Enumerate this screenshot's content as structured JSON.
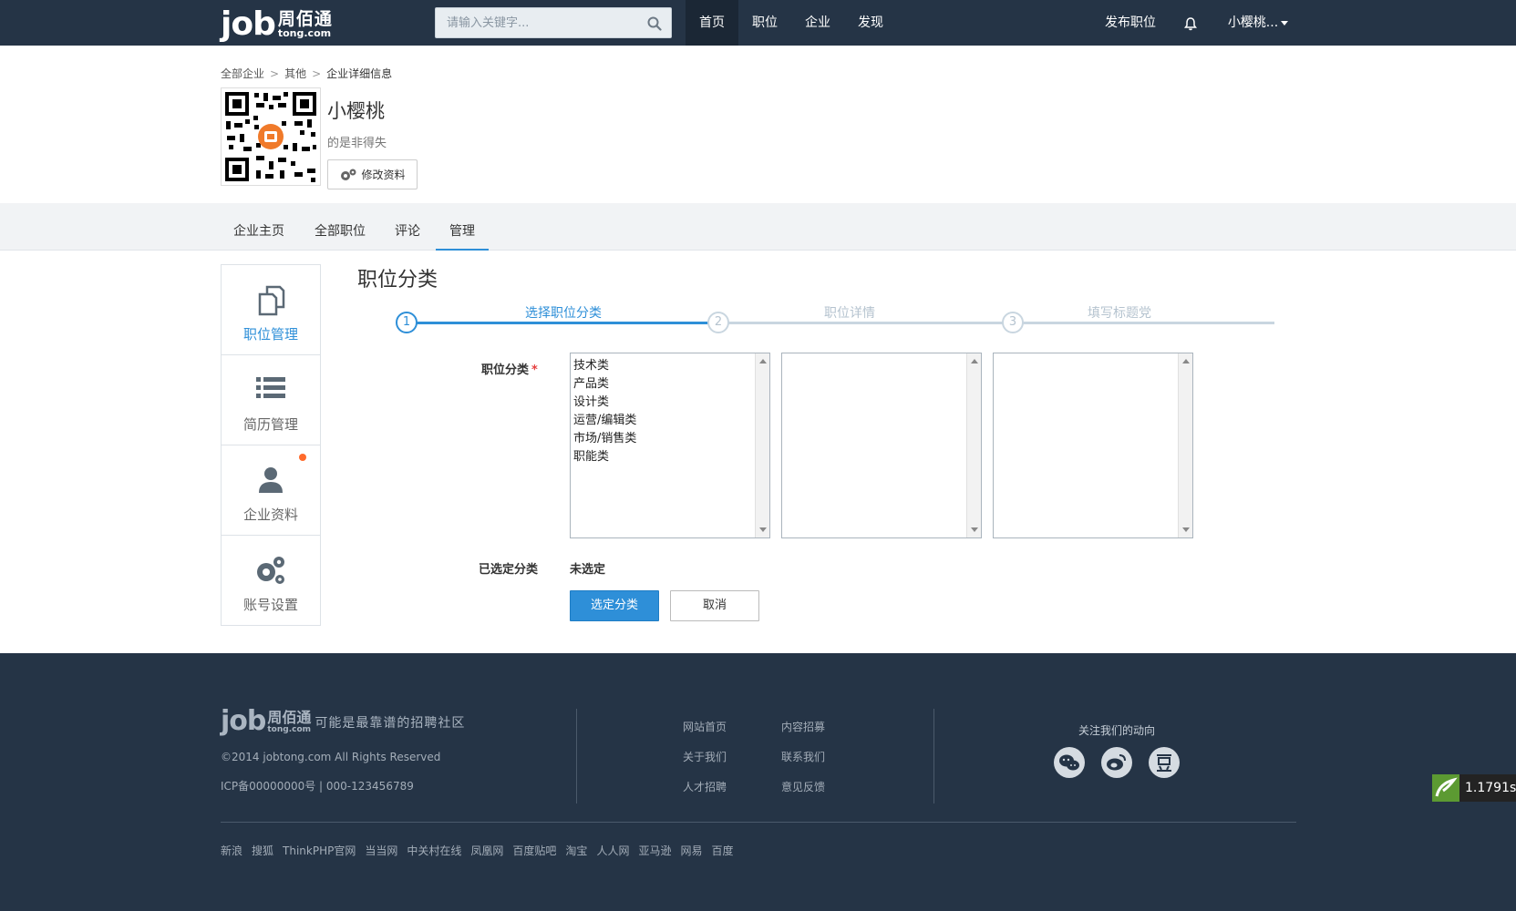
{
  "nav": {
    "logo_job": "job",
    "logo_cn": "周佰通",
    "logo_domain": "tong.com",
    "search_placeholder": "请输入关键字...",
    "items": [
      {
        "label": "首页",
        "active": true
      },
      {
        "label": "职位",
        "active": false
      },
      {
        "label": "企业",
        "active": false
      },
      {
        "label": "发现",
        "active": false
      }
    ],
    "post_job": "发布职位",
    "user": "小樱桃..."
  },
  "breadcrumb": [
    "全部企业",
    "其他",
    "企业详细信息"
  ],
  "company": {
    "name": "小樱桃",
    "desc": "的是非得失",
    "edit_label": "修改资料"
  },
  "tabs": [
    {
      "label": "企业主页",
      "active": false
    },
    {
      "label": "全部职位",
      "active": false
    },
    {
      "label": "评论",
      "active": false
    },
    {
      "label": "管理",
      "active": true
    }
  ],
  "sidebar": [
    {
      "label": "职位管理",
      "icon": "copy-icon",
      "active": true
    },
    {
      "label": "简历管理",
      "icon": "list-icon",
      "active": false
    },
    {
      "label": "企业资料",
      "icon": "user-icon",
      "active": false,
      "badge": true
    },
    {
      "label": "账号设置",
      "icon": "gears-icon",
      "active": false
    }
  ],
  "main": {
    "title": "职位分类",
    "steps": [
      {
        "num": "1",
        "label": "选择职位分类",
        "active": true
      },
      {
        "num": "2",
        "label": "职位详情",
        "active": false
      },
      {
        "num": "3",
        "label": "填写标题党",
        "active": false
      }
    ],
    "category_label": "职位分类",
    "required_mark": "*",
    "categories": [
      "技术类",
      "产品类",
      "设计类",
      "运营/编辑类",
      "市场/销售类",
      "职能类"
    ],
    "selected_label": "已选定分类",
    "selected_value": "未选定",
    "confirm_label": "选定分类",
    "cancel_label": "取消"
  },
  "footer": {
    "logo_job": "job",
    "logo_cn": "周佰通",
    "logo_domain": "tong.com",
    "slogan": "可能是最靠谱的招聘社区",
    "copyright": "©2014 jobtong.com All Rights Reserved",
    "icp": "ICP备00000000号 | 000-123456789",
    "links_col1": [
      "网站首页",
      "关于我们",
      "人才招聘"
    ],
    "links_col2": [
      "内容招募",
      "联系我们",
      "意见反馈"
    ],
    "follow": "关注我们的动向",
    "friends": [
      "新浪",
      "搜狐",
      "ThinkPHP官网",
      "当当网",
      "中关村在线",
      "凤凰网",
      "百度贴吧",
      "淘宝",
      "人人网",
      "亚马逊",
      "网易",
      "百度"
    ]
  },
  "timer": "1.1791s",
  "colors": {
    "accent": "#2e8fd8",
    "navbar": "#253446",
    "badge": "#ff6a2b"
  }
}
